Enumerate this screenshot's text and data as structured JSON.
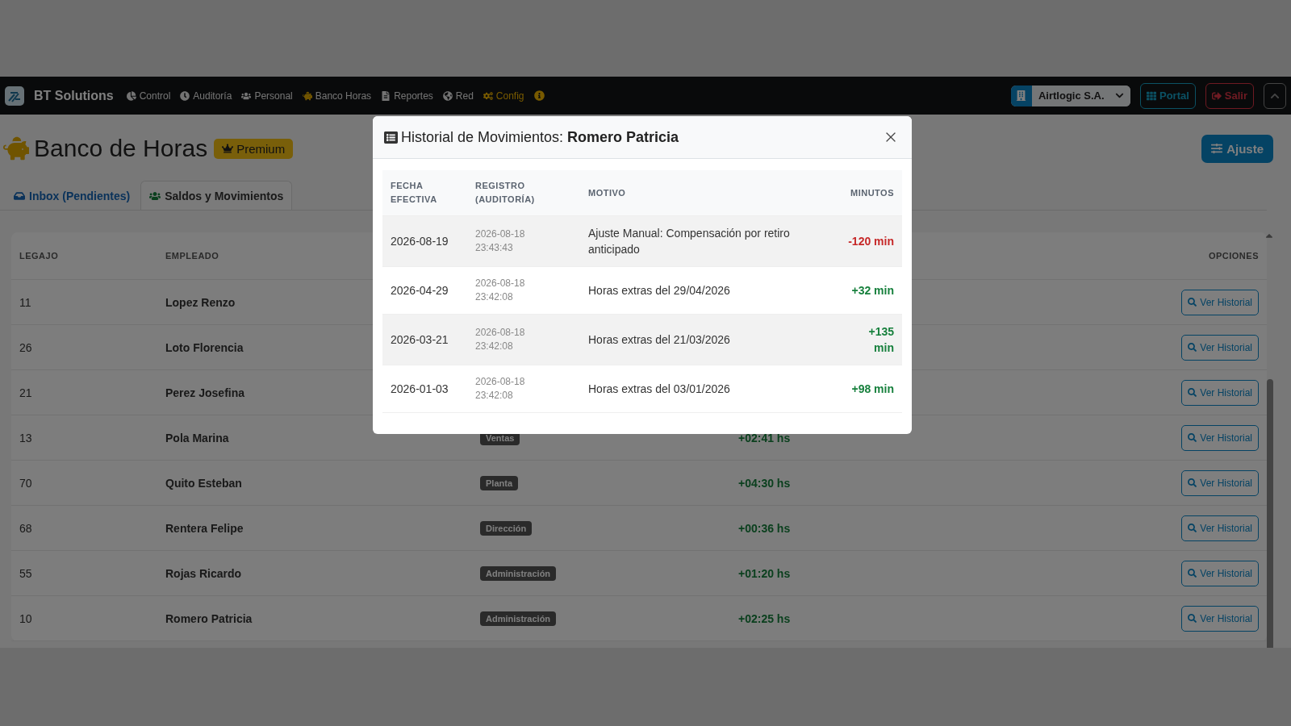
{
  "navbar": {
    "brand": "BT Solutions",
    "items": [
      {
        "label": "Control",
        "kind": "normal"
      },
      {
        "label": "Auditoría",
        "kind": "normal"
      },
      {
        "label": "Personal",
        "kind": "normal"
      },
      {
        "label": "Banco Horas",
        "kind": "normal"
      },
      {
        "label": "Reportes",
        "kind": "normal"
      },
      {
        "label": "Red",
        "kind": "normal"
      },
      {
        "label": "Config",
        "kind": "accent"
      }
    ],
    "company": "Airtlogic S.A.",
    "portal": "Portal",
    "logout": "Salir"
  },
  "page": {
    "title": "Banco de Horas",
    "badge": "Premium",
    "action": "Ajuste"
  },
  "tabs": [
    {
      "label": "Inbox (Pendientes)",
      "selected": false
    },
    {
      "label": "Saldos y Movimientos",
      "selected": true
    }
  ],
  "table": {
    "columns": [
      "LEGAJO",
      "EMPLEADO",
      "OPCIONES"
    ],
    "rows": [
      {
        "legajo": "11",
        "empleado": "Lopez Renzo",
        "button": "Ver Historial"
      },
      {
        "legajo": "26",
        "empleado": "Loto Florencia",
        "button": "Ver Historial"
      },
      {
        "legajo": "21",
        "empleado": "Perez Josefina",
        "button": "Ver Historial"
      },
      {
        "legajo": "13",
        "empleado": "Pola Marina",
        "sector": "Ventas",
        "saldo": "+02:41 hs",
        "button": "Ver Historial"
      },
      {
        "legajo": "70",
        "empleado": "Quito Esteban",
        "sector": "Planta",
        "saldo": "+04:30 hs",
        "button": "Ver Historial"
      },
      {
        "legajo": "68",
        "empleado": "Rentera Felipe",
        "sector": "Dirección",
        "saldo": "+00:36 hs",
        "button": "Ver Historial"
      },
      {
        "legajo": "55",
        "empleado": "Rojas Ricardo",
        "sector": "Administración",
        "saldo": "+01:20 hs",
        "button": "Ver Historial"
      },
      {
        "legajo": "10",
        "empleado": "Romero Patricia",
        "sector": "Administración",
        "saldo": "+02:25 hs",
        "button": "Ver Historial"
      }
    ]
  },
  "modal": {
    "title": "Historial de Movimientos: **Romero Patricia**",
    "columns": [
      "FECHA EFECTIVA",
      "REGISTRO (AUDITORÍA)",
      "MOTIVO",
      "MINUTOS"
    ],
    "rows": [
      {
        "fecha": "2026-08-19",
        "registro": "2026-08-18 23:43:43",
        "motivo": "Ajuste Manual: Compensación por retiro anticipado",
        "minutos": "-120 min",
        "kind": "debit"
      },
      {
        "fecha": "2026-04-29",
        "registro": "2026-08-18 23:42:08",
        "motivo": "Horas extras del 29/04/2026",
        "minutos": "+32 min",
        "kind": "credit"
      },
      {
        "fecha": "2026-03-21",
        "registro": "2026-08-18 23:42:08",
        "motivo": "Horas extras del 21/03/2026",
        "minutos": "+135 min",
        "kind": "credit"
      },
      {
        "fecha": "2026-01-03",
        "registro": "2026-08-18 23:42:08",
        "motivo": "Horas extras del 03/01/2026",
        "minutos": "+98 min",
        "kind": "credit"
      }
    ]
  }
}
